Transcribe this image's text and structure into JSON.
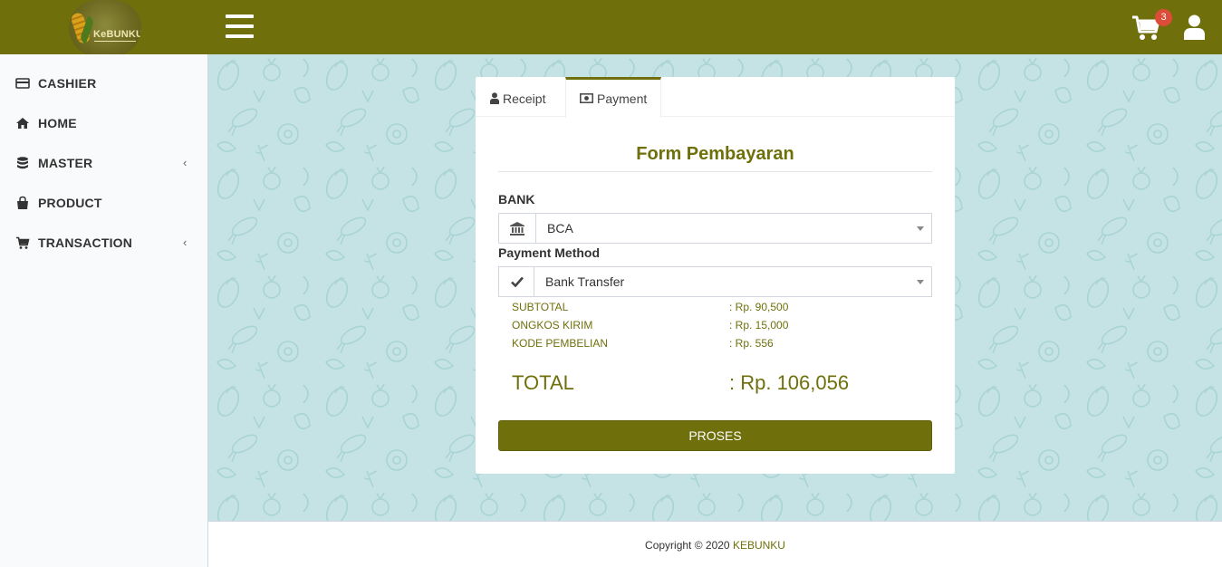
{
  "header": {
    "logo_text": "KeBUNKU",
    "cart_count": "3",
    "bg_color": "#6f700b"
  },
  "sidebar": {
    "items": [
      {
        "label": "CASHIER",
        "icon": "credit-card-icon",
        "has_submenu": false
      },
      {
        "label": "HOME",
        "icon": "home-icon",
        "has_submenu": false
      },
      {
        "label": "MASTER",
        "icon": "database-icon",
        "has_submenu": true
      },
      {
        "label": "PRODUCT",
        "icon": "shopping-bag-icon",
        "has_submenu": false
      },
      {
        "label": "TRANSACTION",
        "icon": "cart-icon",
        "has_submenu": true
      }
    ]
  },
  "tabs": [
    {
      "label": "Receipt",
      "icon": "user-icon",
      "active": false
    },
    {
      "label": "Payment",
      "icon": "money-icon",
      "active": true
    }
  ],
  "form": {
    "title": "Form Pembayaran",
    "bank_label": "BANK",
    "bank_value": "BCA",
    "bank_icon": "bank-icon",
    "method_label": "Payment Method",
    "method_value": "Bank Transfer",
    "method_icon": "check-icon",
    "summary": [
      {
        "label": "SUBTOTAL",
        "value": ": Rp. 90,500"
      },
      {
        "label": "ONGKOS KIRIM",
        "value": ": Rp. 15,000"
      },
      {
        "label": "KODE PEMBELIAN",
        "value": ": Rp. 556"
      }
    ],
    "total_label": "TOTAL",
    "total_value": ": Rp. 106,056",
    "submit_label": "PROSES"
  },
  "footer": {
    "copyright": "Copyright © 2020",
    "brand": "KEBUNKU"
  }
}
